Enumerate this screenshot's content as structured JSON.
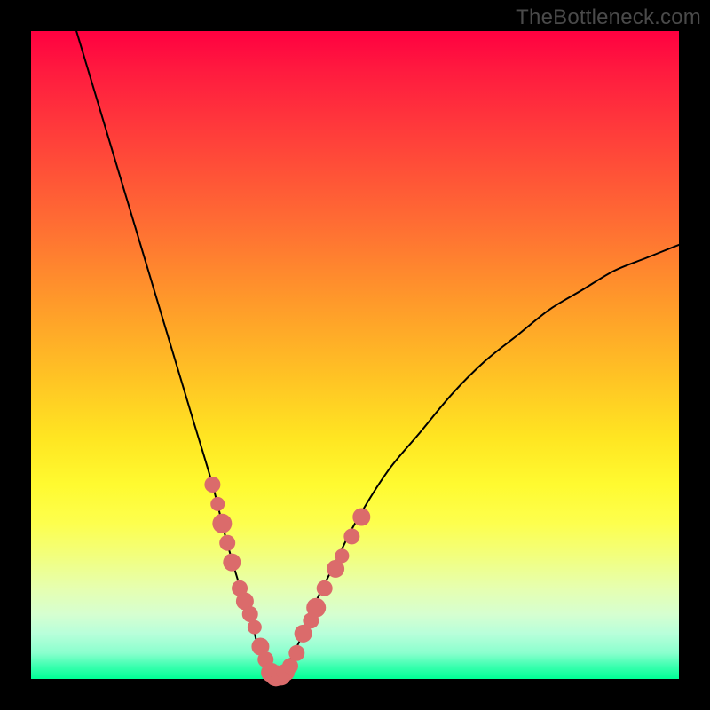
{
  "watermark": "TheBottleneck.com",
  "colors": {
    "frame": "#000000",
    "curve": "#000000",
    "marker": "#db6b6b"
  },
  "chart_data": {
    "type": "line",
    "title": "",
    "xlabel": "",
    "ylabel": "",
    "xlim": [
      0,
      100
    ],
    "ylim": [
      0,
      100
    ],
    "grid": false,
    "legend": false,
    "x_optimum": 37,
    "series": [
      {
        "name": "bottleneck-curve",
        "x": [
          7,
          10,
          13,
          16,
          19,
          22,
          25,
          28,
          30,
          32,
          34,
          35,
          36,
          37,
          38,
          39,
          40,
          42,
          44,
          47,
          50,
          55,
          60,
          65,
          70,
          75,
          80,
          85,
          90,
          95,
          100
        ],
        "values": [
          100,
          90,
          80,
          70,
          60,
          50,
          40,
          30,
          22,
          15,
          9,
          5,
          2,
          0,
          0,
          1,
          3,
          7,
          12,
          18,
          24,
          32,
          38,
          44,
          49,
          53,
          57,
          60,
          63,
          65,
          67
        ]
      }
    ],
    "markers": {
      "name": "highlighted-points",
      "x": [
        28,
        28.8,
        29.5,
        30.3,
        31,
        32.2,
        33,
        33.8,
        34.5,
        35.4,
        36.2,
        37,
        37.8,
        38.6,
        39.3,
        40,
        41,
        42,
        43.2,
        44,
        45.3,
        47,
        48,
        49.5,
        51
      ],
      "values": [
        30,
        27,
        24,
        21,
        18,
        14,
        12,
        10,
        8,
        5,
        3,
        1,
        0.5,
        0.5,
        1,
        2,
        4,
        7,
        9,
        11,
        14,
        17,
        19,
        22,
        25
      ],
      "radius": [
        9,
        8,
        11,
        9,
        10,
        9,
        10,
        9,
        8,
        10,
        9,
        11,
        12,
        11,
        10,
        9,
        9,
        10,
        9,
        11,
        9,
        10,
        8,
        9,
        10
      ]
    }
  }
}
